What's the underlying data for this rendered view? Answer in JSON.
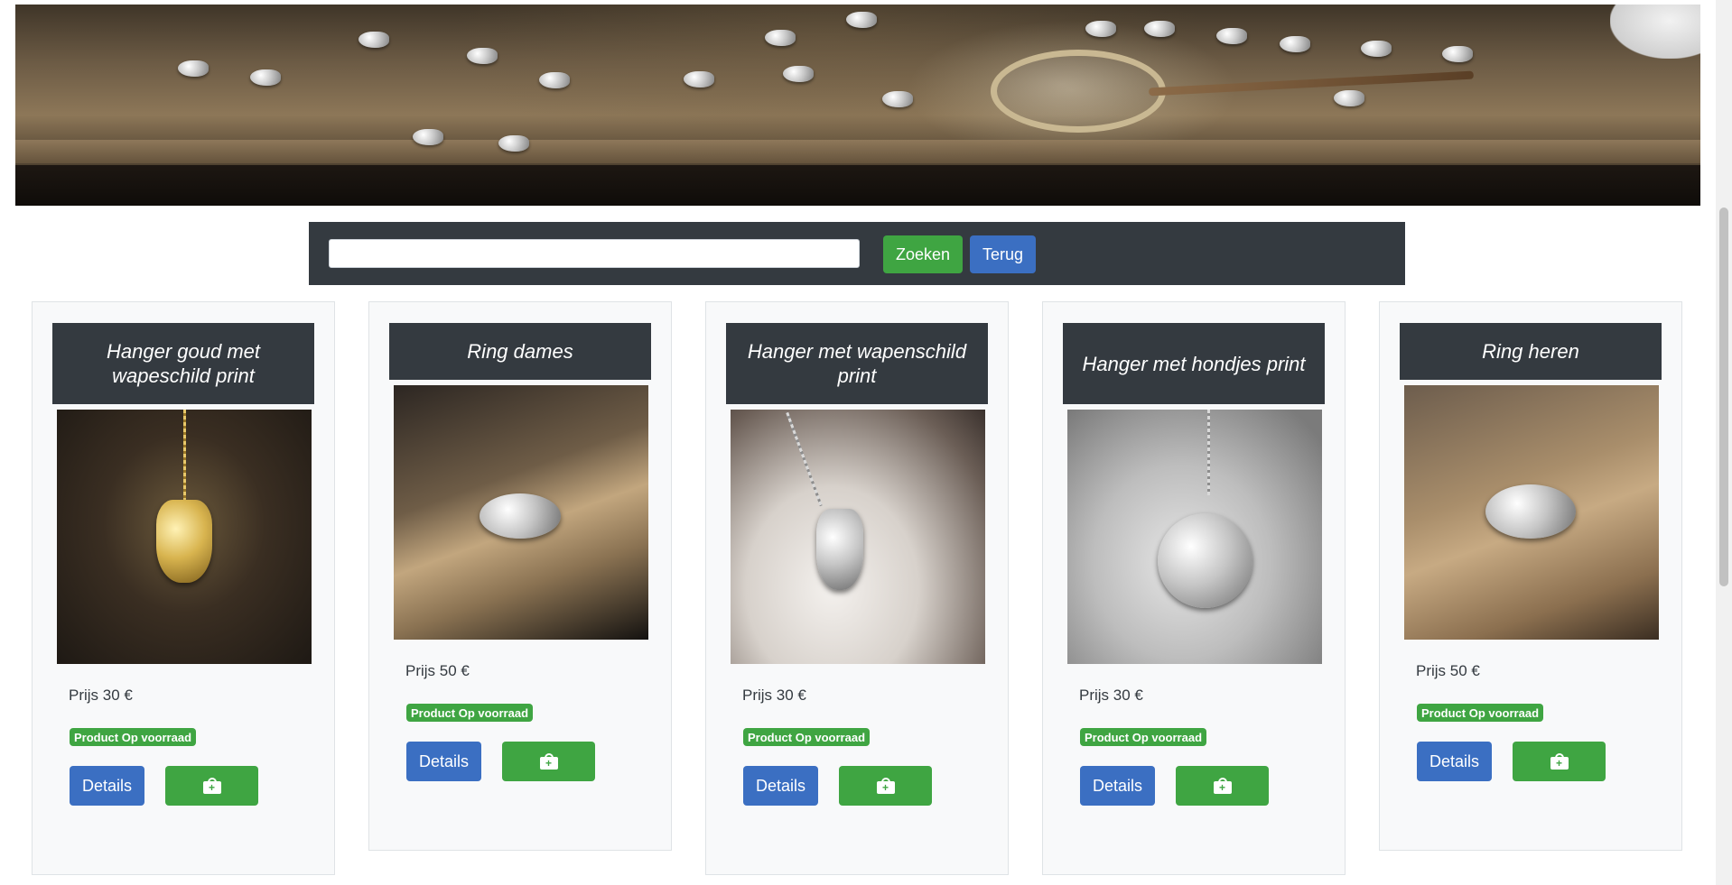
{
  "hero": {
    "image": "jewelry-workbench-banner"
  },
  "search": {
    "value": "",
    "placeholder": "",
    "search_label": "Zoeken",
    "back_label": "Terug"
  },
  "products": [
    {
      "title": "Hanger goud met wapeschild print",
      "price": "Prijs 30 €",
      "stock": "Product Op voorraad",
      "details_label": "Details",
      "cart_icon": "shopping-bag-plus-icon"
    },
    {
      "title": "Ring dames",
      "price": "Prijs 50 €",
      "stock": "Product Op voorraad",
      "details_label": "Details",
      "cart_icon": "shopping-bag-plus-icon"
    },
    {
      "title": "Hanger met wapenschild print",
      "price": "Prijs 30 €",
      "stock": "Product Op voorraad",
      "details_label": "Details",
      "cart_icon": "shopping-bag-plus-icon"
    },
    {
      "title": "Hanger met hondjes print",
      "price": "Prijs 30 €",
      "stock": "Product Op voorraad",
      "details_label": "Details",
      "cart_icon": "shopping-bag-plus-icon"
    },
    {
      "title": "Ring heren",
      "price": "Prijs 50 €",
      "stock": "Product Op voorraad",
      "details_label": "Details",
      "cart_icon": "shopping-bag-plus-icon"
    }
  ],
  "colors": {
    "navbar": "#343a40",
    "success": "#3fa542",
    "primary": "#3b6fc2",
    "card_bg": "#f8f9fa"
  }
}
